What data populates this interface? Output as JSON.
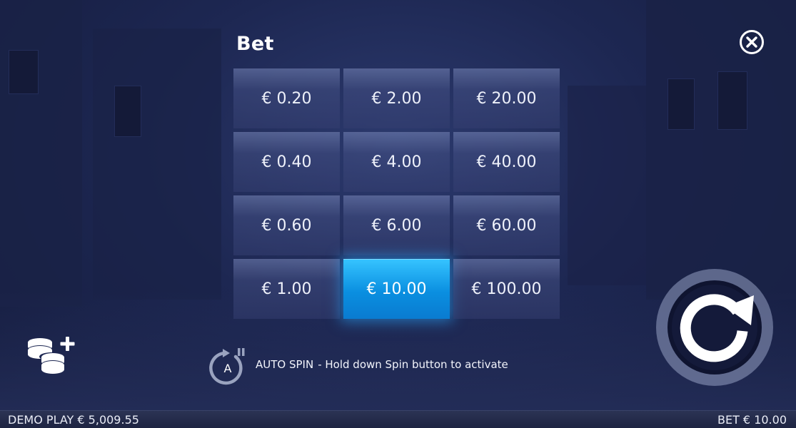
{
  "panel": {
    "title": "Bet"
  },
  "bet_options": [
    {
      "label": "€ 0.20",
      "selected": false
    },
    {
      "label": "€ 2.00",
      "selected": false
    },
    {
      "label": "€ 20.00",
      "selected": false
    },
    {
      "label": "€ 0.40",
      "selected": false
    },
    {
      "label": "€ 4.00",
      "selected": false
    },
    {
      "label": "€ 40.00",
      "selected": false
    },
    {
      "label": "€ 0.60",
      "selected": false
    },
    {
      "label": "€ 6.00",
      "selected": false
    },
    {
      "label": "€ 60.00",
      "selected": false
    },
    {
      "label": "€ 1.00",
      "selected": false
    },
    {
      "label": "€ 10.00",
      "selected": true
    },
    {
      "label": "€ 100.00",
      "selected": false
    }
  ],
  "autospin": {
    "icon": "autospin-icon",
    "icon_letter": "A",
    "label": "AUTO SPIN",
    "hint": "- Hold down Spin button to activate"
  },
  "bottom_bar": {
    "balance": "DEMO PLAY € 5,009.55",
    "bet": "BET € 10.00"
  },
  "icons": {
    "close": "close-icon",
    "coins": "coin-stack-plus-icon",
    "spin": "spin-arrow-icon"
  },
  "colors": {
    "selected_accent": "#1aa8f5",
    "background": "#1d2752"
  }
}
